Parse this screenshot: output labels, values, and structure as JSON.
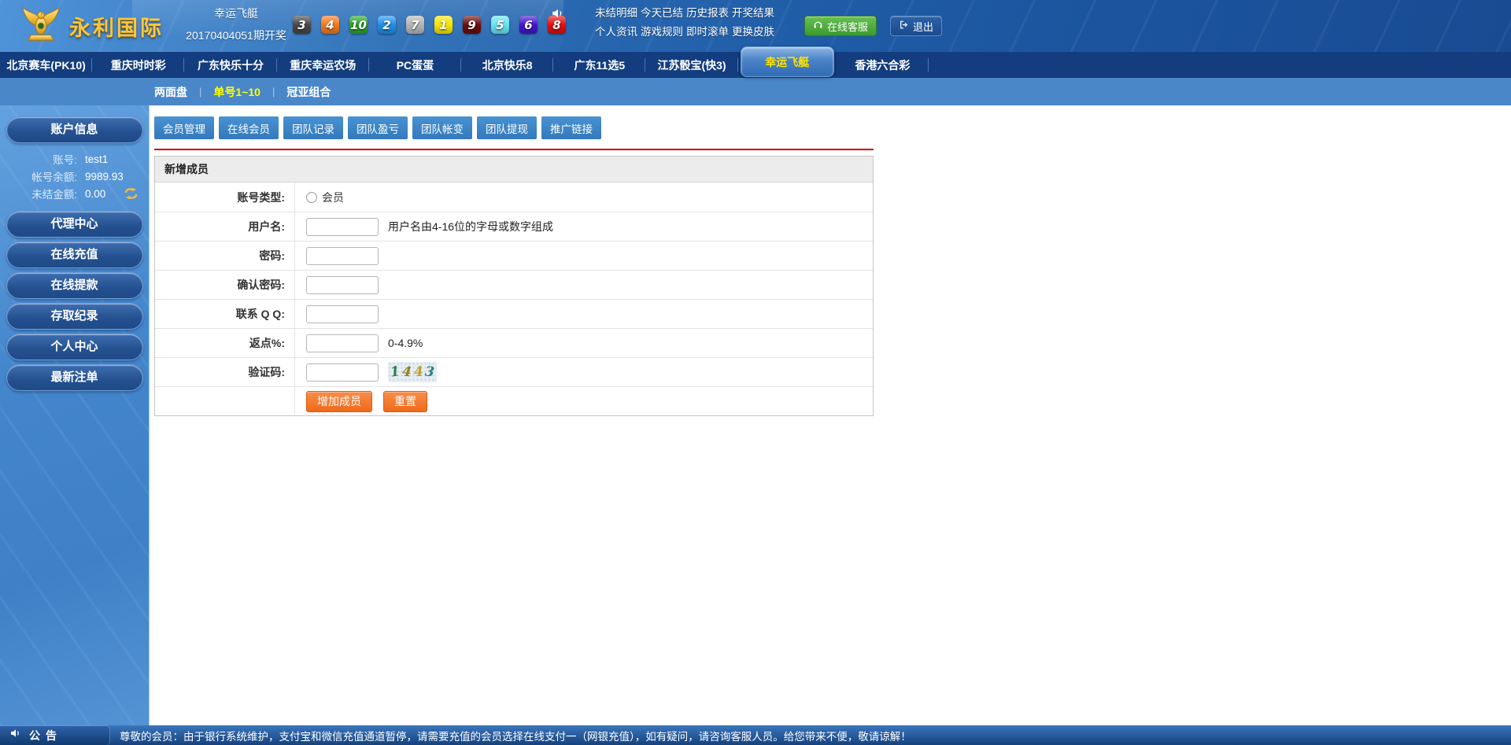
{
  "header": {
    "logo_text": "永利国际",
    "draw": {
      "game_name": "幸运飞艇",
      "issue_text": "20170404051期开奖",
      "balls": [
        {
          "n": "3",
          "bg": "#474747",
          "fg": "#ffffff"
        },
        {
          "n": "4",
          "bg": "#f2791c",
          "fg": "#ffffff"
        },
        {
          "n": "10",
          "bg": "#2ca52c",
          "fg": "#ffffff"
        },
        {
          "n": "2",
          "bg": "#1e8fe8",
          "fg": "#ffffff"
        },
        {
          "n": "7",
          "bg": "#b5b5b5",
          "fg": "#ffffff"
        },
        {
          "n": "1",
          "bg": "#f5e400",
          "fg": "#ffffff"
        },
        {
          "n": "9",
          "bg": "#6b0d0d",
          "fg": "#ffffff"
        },
        {
          "n": "5",
          "bg": "#66e3f0",
          "fg": "#ffffff"
        },
        {
          "n": "6",
          "bg": "#4414cc",
          "fg": "#ffffff"
        },
        {
          "n": "8",
          "bg": "#e00e0e",
          "fg": "#ffffff"
        }
      ]
    },
    "menu_row1": [
      "未结明细",
      "今天已结",
      "历史报表",
      "开奖结果"
    ],
    "menu_row2": [
      "个人资讯",
      "游戏规则",
      "即时滚单",
      "更换皮肤"
    ],
    "service_button": "在线客服",
    "logout_button": "退出"
  },
  "nav": {
    "tabs": [
      "北京赛车(PK10)",
      "重庆时时彩",
      "广东快乐十分",
      "重庆幸运农场",
      "PC蛋蛋",
      "北京快乐8",
      "广东11选5",
      "江苏骰宝(快3)",
      "幸运飞艇",
      "香港六合彩"
    ],
    "active_tab": "幸运飞艇"
  },
  "subnav": {
    "items": [
      "两面盘",
      "单号1~10",
      "冠亚组合"
    ],
    "active_item": "单号1~10",
    "separator": "|"
  },
  "sidebar": {
    "account_button": "账户信息",
    "info": [
      {
        "label": "账号:",
        "value": "test1"
      },
      {
        "label": "帐号余额:",
        "value": "9989.93"
      },
      {
        "label": "未结金额:",
        "value": "0.00"
      }
    ],
    "buttons": [
      "代理中心",
      "在线充值",
      "在线提款",
      "存取纪录",
      "个人中心",
      "最新注单"
    ]
  },
  "main": {
    "tabs": [
      "会员管理",
      "在线会员",
      "团队记录",
      "团队盈亏",
      "团队帐变",
      "团队提现",
      "推广链接"
    ],
    "form": {
      "title": "新增成员",
      "account_type": {
        "label": "账号类型:",
        "option": "会员",
        "checked": false
      },
      "username": {
        "label": "用户名:",
        "value": "",
        "hint": "用户名由4-16位的字母或数字组成"
      },
      "password": {
        "label": "密码:",
        "value": ""
      },
      "confirm_password": {
        "label": "确认密码:",
        "value": ""
      },
      "qq": {
        "label": "联系 Q Q:",
        "value": ""
      },
      "rebate": {
        "label": "返点%:",
        "value": "",
        "hint": "0-4.9%"
      },
      "captcha": {
        "label": "验证码:",
        "value": "",
        "digits": [
          {
            "d": "1",
            "c": "#2f7d46"
          },
          {
            "d": "4",
            "c": "#8f841c"
          },
          {
            "d": "4",
            "c": "#bfa023"
          },
          {
            "d": "3",
            "c": "#2e7f7c"
          }
        ]
      },
      "submit_button": "增加成员",
      "reset_button": "重置"
    }
  },
  "footer": {
    "label": "公告",
    "text": "尊敬的会员：由于银行系统维护，支付宝和微信充值通道暂停，请需要充值的会员选择在线支付一（网银充值），如有疑问，请咨询客服人员。给您带来不便，敬请谅解！"
  },
  "colors": {
    "accent_red": "#cc0000",
    "nav_bar": "#133d7e",
    "subnav_bar": "#4a87c9",
    "content_tab_blue": "#3c87c8",
    "button_orange": "#f06a1a",
    "service_green": "#3c9a2e",
    "active_text_yellow": "#ffe400"
  }
}
